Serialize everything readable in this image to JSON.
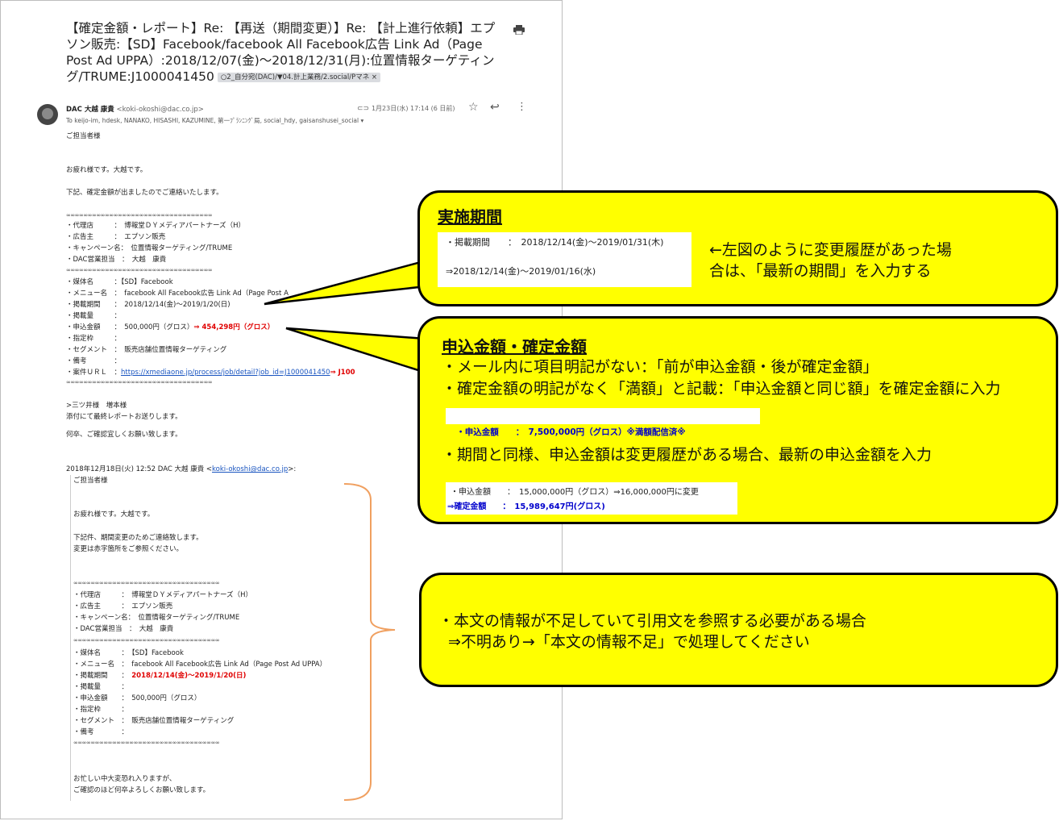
{
  "email": {
    "subject": "【確定金額・レポート】Re: 【再送（期間変更）】Re: 【計上進行依頼】エプソン販売:【SD】Facebook/facebook All Facebook広告 Link Ad（Page Post Ad UPPA）:2018/12/07(金)〜2018/12/31(月):位置情報ターゲティング/TRUME:J1000041450",
    "label_chip": "○2_自分宛(DAC)/▼04.計上業務/2.social/Pマネ ×",
    "sender_name": "DAC 大越 康貴",
    "sender_addr": "<koki-okoshi@dac.co.jp>",
    "date": "1月23日(水) 17:14 (6 日前)",
    "to_line": "To keijo-im, hdesk, NANAKO, HISASHI, KAZUMINE, 第一ﾌﾟﾗﾝﾆﾝｸﾞ局, social_hdy, gaisanshusei_social ▾",
    "greeting": "ご担当者様",
    "intro1": "お疲れ様です。大越です。",
    "intro2": "下記、確定金額が出ましたのでご連絡いたします。",
    "separator": "∞∞∞∞∞∞∞∞∞∞∞∞∞∞∞∞∞∞∞∞∞∞∞∞∞∞∞∞∞∞∞∞∞∞",
    "block1": "・代理店　　　：　博報堂ＤＹメディアパートナーズ（H）\n・広告主　　　：　エプソン販売\n・キャンペーン名：　位置情報ターゲティング/TRUME\n・DAC営業担当　：　大越　康貴",
    "block2": "・媒体名　　　：【SD】Facebook\n・メニュー名　：　facebook All Facebook広告 Link Ad（Page Post A\n・掲載期間　　：　2018/12/14(金)〜2019/1/20(日)\n・掲載量　　　：",
    "amount_label": "・申込金額　　：　500,000円（グロス）",
    "amount_arrow": "⇒ ",
    "amount_new": "454,298円（グロス）",
    "block3": "・指定枠　　　：\n・セグメント　：　販売店舗位置情報ターゲティング\n・備考　　　　：",
    "url_label": "・案件ＵＲＬ　：",
    "url": "https://xmediaone.jp/process/job/detail?job_id=J1000041450",
    "url_suffix": "⇒ J100",
    "reply1": ">三ツ井様　増本様",
    "reply2": "添付にて最終レポートお送りします。",
    "reply3": "何卒、ご確認宜しくお願い致します。",
    "quote_header": "2018年12月18日(火) 12:52 DAC 大越 康貴 <",
    "quote_header_link": "koki-okoshi@dac.co.jp",
    "quote_header_end": ">:",
    "quote": {
      "greeting": "ご担当者様",
      "intro1": "お疲れ様です。大越です。",
      "intro2": "下記件、期間変更のためご連絡致します。\n変更は赤字箇所をご参照ください。",
      "block1": "・代理店　　　：　博報堂ＤＹメディアパートナーズ（H）\n・広告主　　　：　エプソン販売\n・キャンペーン名：　位置情報ターゲティング/TRUME\n・DAC営業担当　：　大越　康貴",
      "block2a": "・媒体名　　　：　【SD】Facebook\n・メニュー名　：　facebook All Facebook広告 Link Ad（Page Post Ad UPPA）",
      "period_label": "・掲載期間　　：　",
      "period_value": "2018/12/14(金)〜2019/1/20(日)",
      "block2b": "・掲載量　　　：\n・申込金額　　：　500,000円（グロス）\n・指定枠　　　：\n・セグメント　：　販売店舗位置情報ターゲティング\n・備考　　　　：",
      "closing": "お忙しい中大変恐れ入りますが、\nご確認のほど何卒よろしくお願い致します。"
    }
  },
  "callout_period": {
    "title": "実施期間",
    "inset_line1": "・掲載期間　　：　2018/12/14(金)〜2019/01/31(木)",
    "inset_line2": "⇒2018/12/14(金)〜2019/01/16(水)",
    "text1": "←左図のように変更履歴があった場",
    "text2": "合は、「最新の期間」を入力する"
  },
  "callout_amount": {
    "title": "申込金額・確定金額",
    "line1": "・メール内に項目明記がない：「前が申込金額・後が確定金額」",
    "line2": "・確定金額の明記がなく「満額」と記載：「申込金額と同じ額」を確定金額に入力",
    "inset1": "・申込金額　　：　7,500,000円（グロス）※満額配信済※",
    "line3": "・期間と同様、申込金額は変更履歴がある場合、最新の申込金額を入力",
    "inset2_line1": "・申込金額　　：　15,000,000円（グロス）⇒16,000,000円に変更",
    "inset2_line2": "⇒確定金額　　：　15,989,647円(グロス)"
  },
  "callout_insufficient": {
    "line1": "・本文の情報が不足していて引用文を参照する必要がある場合",
    "line2": "⇒不明あり→「本文の情報不足」で処理してください"
  },
  "colors": {
    "callout_bg": "#ffff00",
    "bracket": "#f0a060",
    "emphasis_red": "#e00000",
    "inset_blue": "#0000cc"
  }
}
